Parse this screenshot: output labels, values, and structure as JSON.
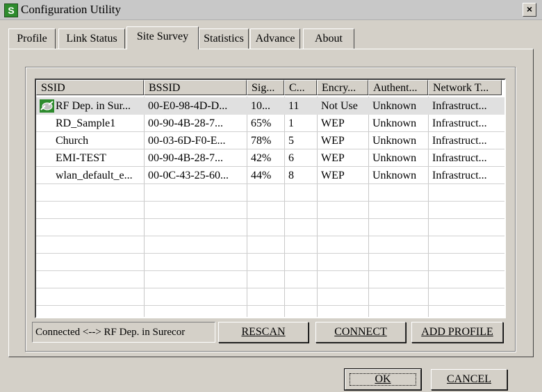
{
  "window": {
    "title": "Configuration Utility",
    "app_icon": "S",
    "close_label": "×"
  },
  "tabs": [
    {
      "label": "Profile"
    },
    {
      "label": "Link Status"
    },
    {
      "label": "Site Survey",
      "active": true
    },
    {
      "label": "Statistics"
    },
    {
      "label": "Advance"
    },
    {
      "label": "About"
    }
  ],
  "table": {
    "columns": [
      "SSID",
      "BSSID",
      "Sig...",
      "C...",
      "Encry...",
      "Authent...",
      "Network T..."
    ],
    "rows": [
      [
        "RF Dep. in Sur...",
        "00-E0-98-4D-D...",
        "10...",
        "11",
        "Not Use",
        "Unknown",
        "Infrastruct..."
      ],
      [
        "RD_Sample1",
        "00-90-4B-28-7...",
        "65%",
        "1",
        "WEP",
        "Unknown",
        "Infrastruct..."
      ],
      [
        "Church",
        "00-03-6D-F0-E...",
        "78%",
        "5",
        "WEP",
        "Unknown",
        "Infrastruct..."
      ],
      [
        "EMI-TEST",
        "00-90-4B-28-7...",
        "42%",
        "6",
        "WEP",
        "Unknown",
        "Infrastruct..."
      ],
      [
        "wlan_default_e...",
        "00-0C-43-25-60...",
        "44%",
        "8",
        "WEP",
        "Unknown",
        "Infrastruct..."
      ]
    ],
    "connected_row_icon": "connected-signal-icon",
    "selected_row_bg": "#e0e0e0"
  },
  "status": {
    "text": "Connected <--> RF Dep. in Surecor"
  },
  "buttons": {
    "rescan": "RESCAN",
    "connect": "CONNECT",
    "add_profile": "ADD PROFILE",
    "ok": "OK",
    "cancel": "CANCEL"
  },
  "colors": {
    "window_bg": "#d4d0c8",
    "list_bg": "#ffffff",
    "icon_green": "#2e8b2e"
  }
}
